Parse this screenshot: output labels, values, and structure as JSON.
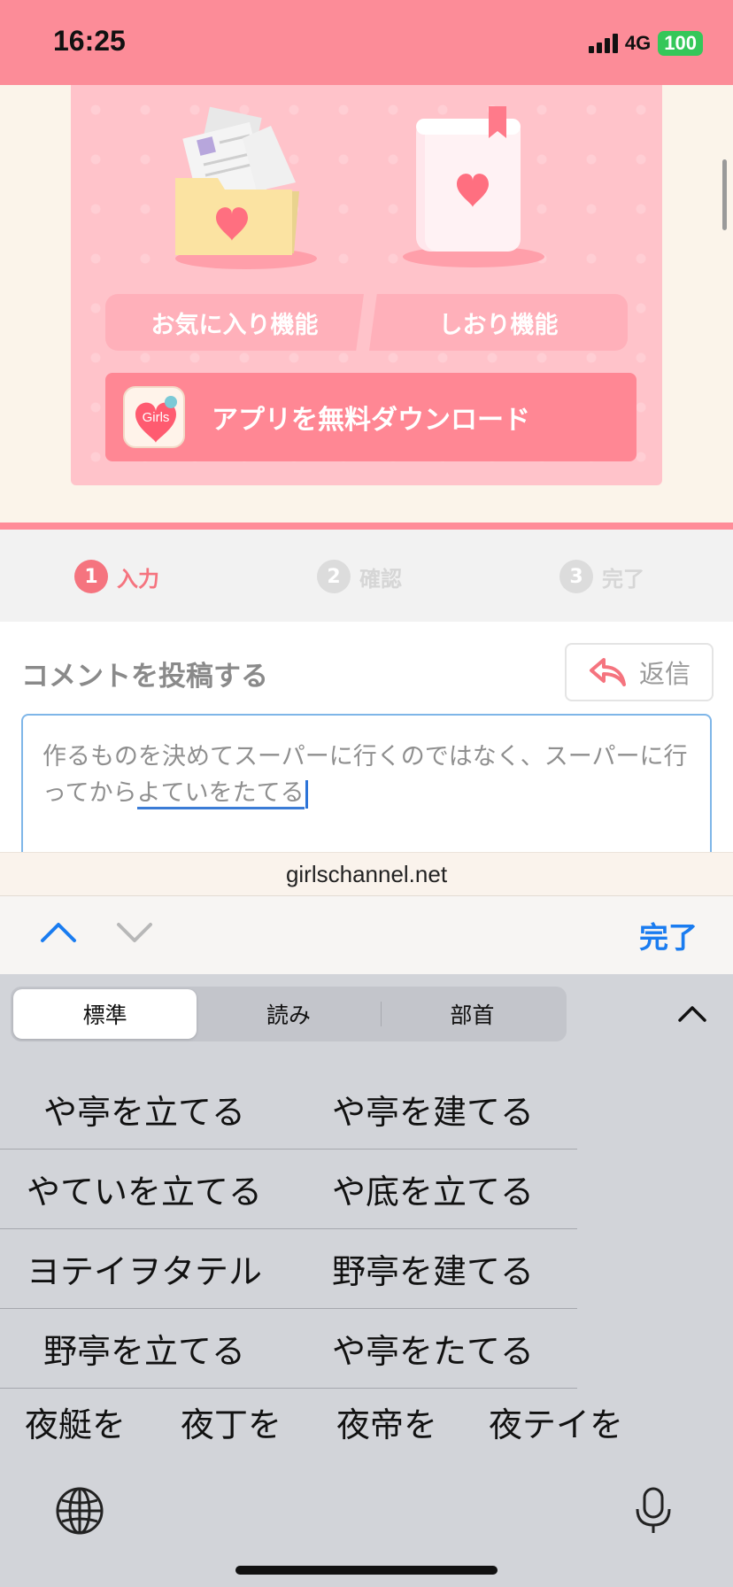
{
  "status_bar": {
    "time": "16:25",
    "network": "4G",
    "battery": "100"
  },
  "banner": {
    "favorites_label": "お気に入り機能",
    "bookmark_label": "しおり機能",
    "download_label": "アプリを無料ダウンロード",
    "app_icon_text": "Girls"
  },
  "steps": [
    {
      "num": "1",
      "label": "入力"
    },
    {
      "num": "2",
      "label": "確認"
    },
    {
      "num": "3",
      "label": "完了"
    }
  ],
  "comment": {
    "title": "コメントを投稿する",
    "reply_label": "返信",
    "text_committed": "作るものを決めてスーパーに行くのではなく、スーパーに行ってから",
    "text_composing": "よていをたてる"
  },
  "url_bar": {
    "domain": "girlschannel.net"
  },
  "accessory": {
    "done_label": "完了"
  },
  "keyboard": {
    "tabs": [
      "標準",
      "読み",
      "部首"
    ],
    "candidates": [
      [
        "や亭を立てる",
        "や亭を建てる"
      ],
      [
        "やていを立てる",
        "や底を立てる"
      ],
      [
        "ヨテイヲタテル",
        "野亭を建てる"
      ],
      [
        "野亭を立てる",
        "や亭をたてる"
      ]
    ],
    "short_candidates": [
      "夜艇を",
      "夜丁を",
      "夜帝を",
      "夜テイを"
    ]
  },
  "colors": {
    "status_bar": "#fc8c98",
    "accent_pink": "#f5747f",
    "ios_blue": "#1a7cf0",
    "battery_green": "#35c759"
  },
  "icons": [
    "globe-icon",
    "microphone-icon",
    "reply-arrow-icon",
    "chevron-up-icon",
    "chevron-down-icon"
  ]
}
